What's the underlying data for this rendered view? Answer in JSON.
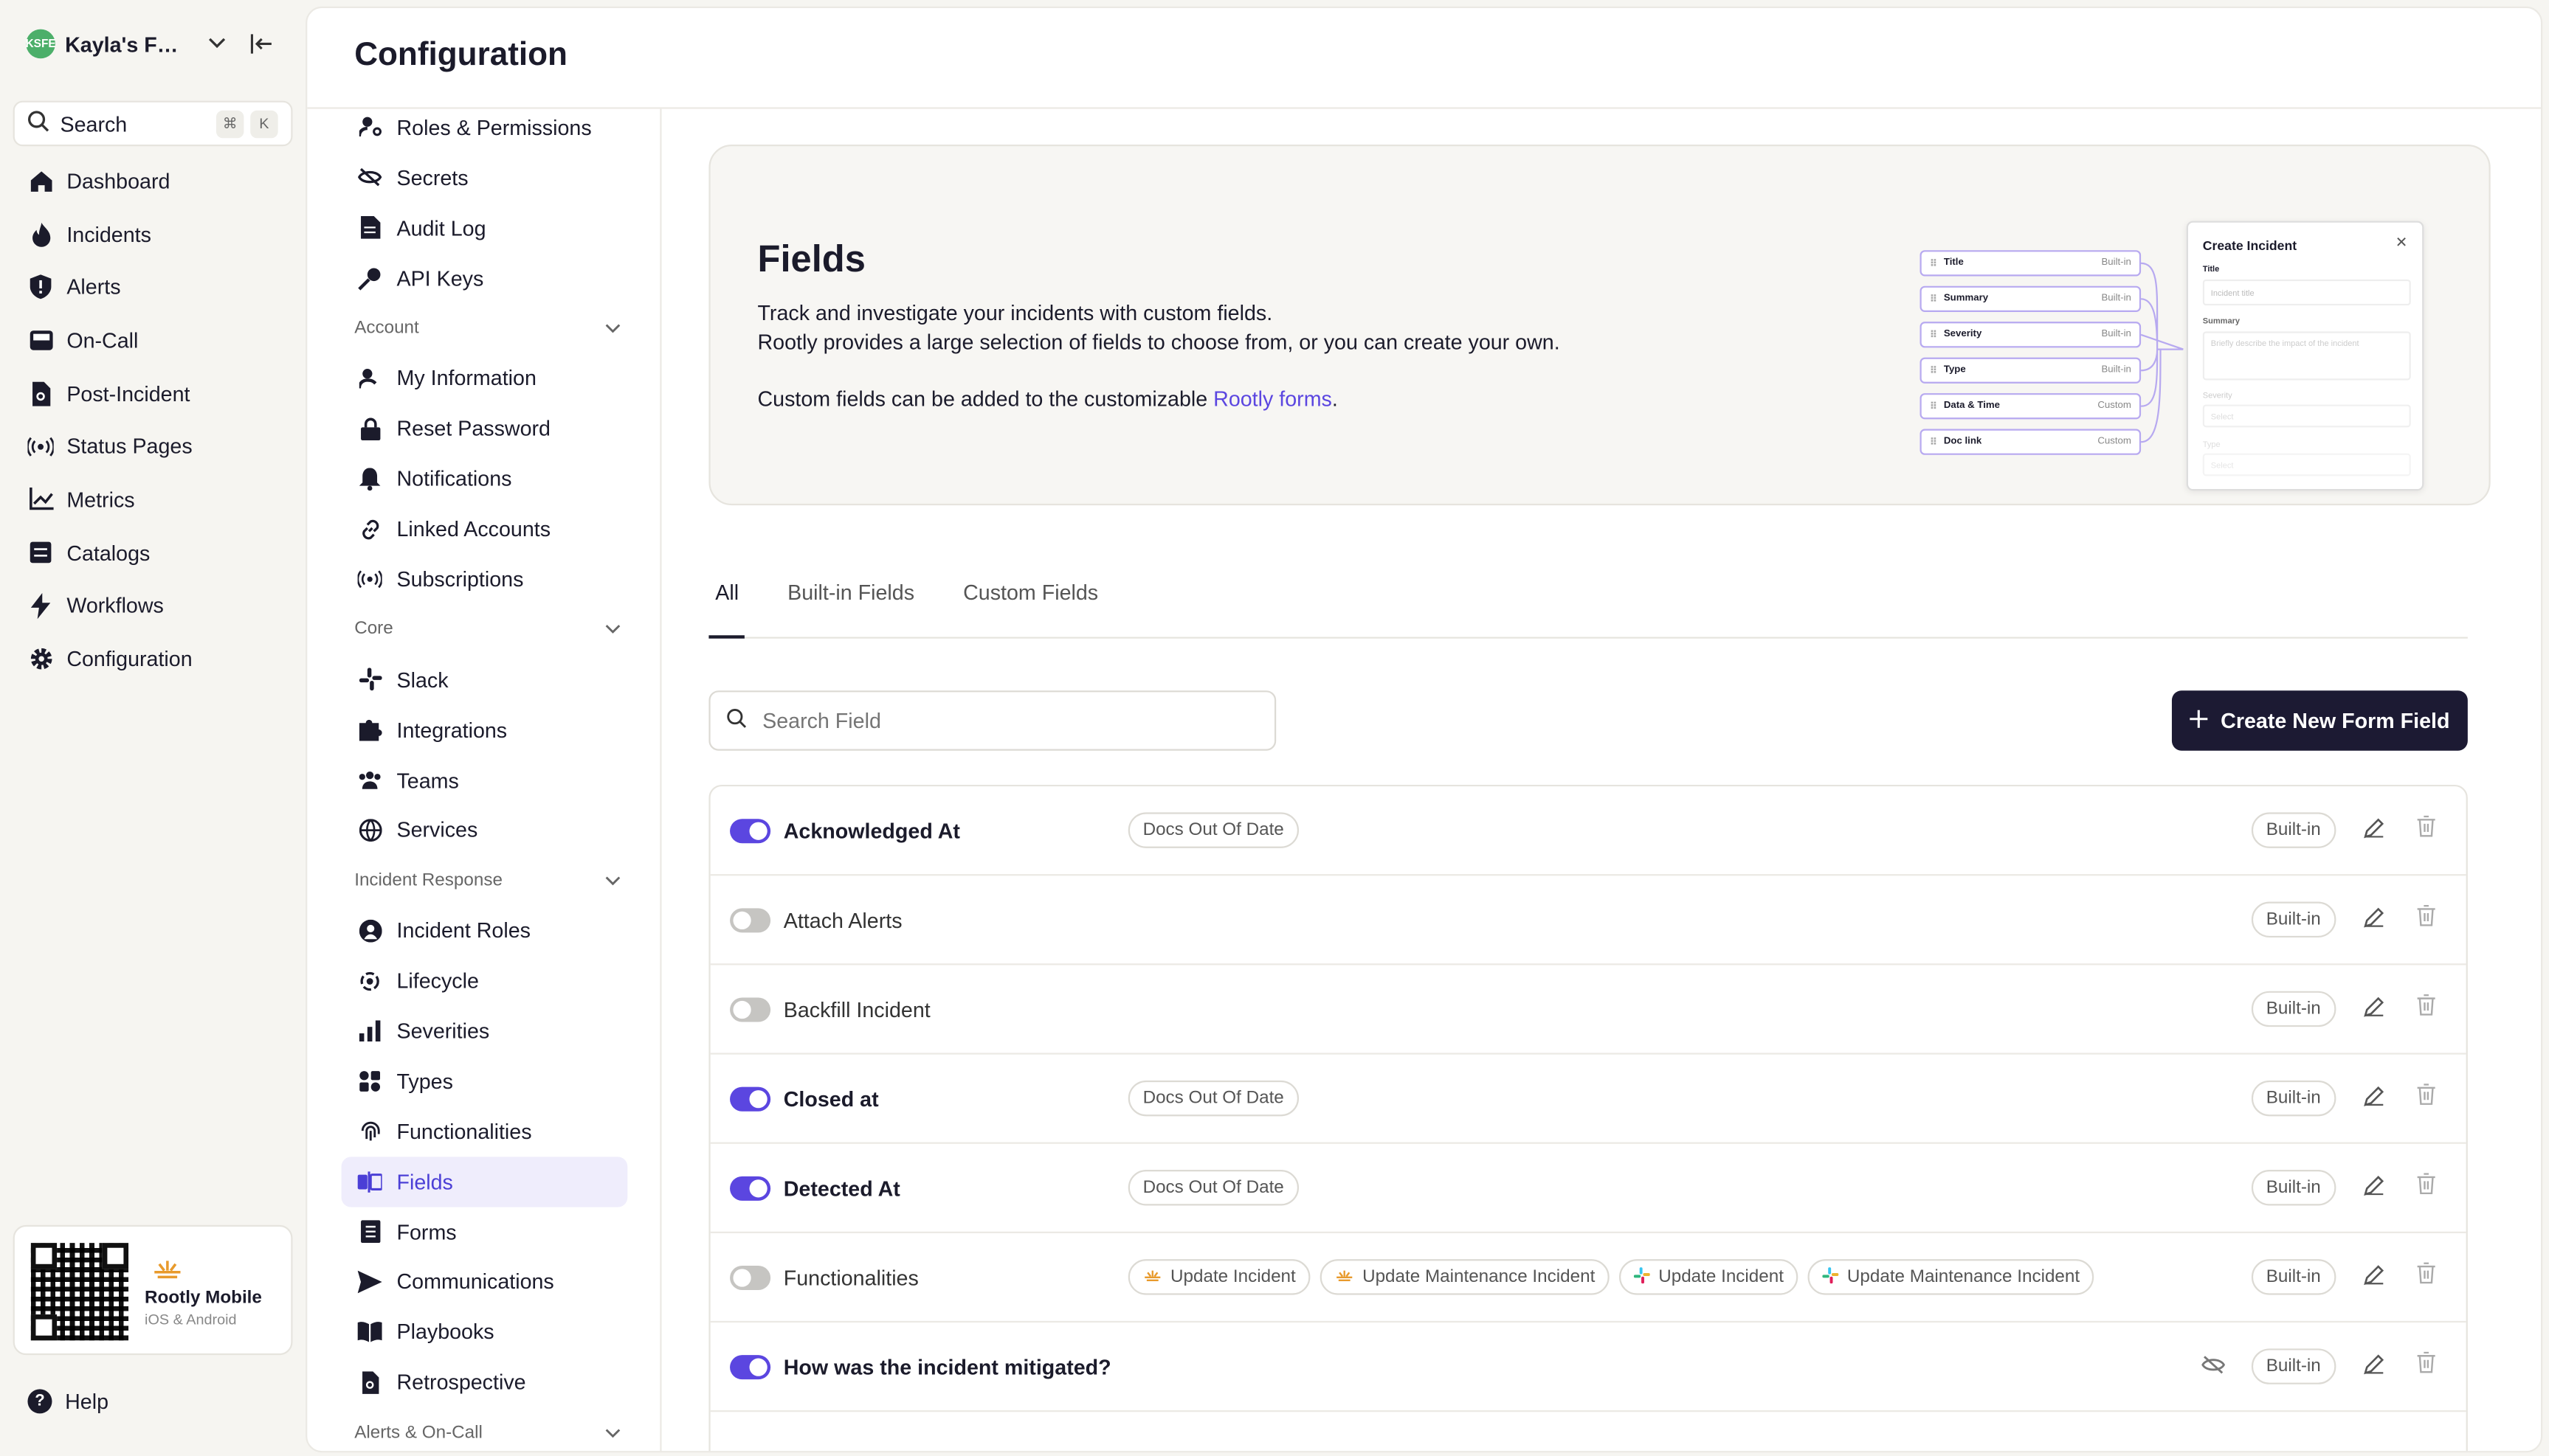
{
  "org": {
    "initials": "KSFE",
    "name": "Kayla's Fu..."
  },
  "search": {
    "label": "Search",
    "shortcut_cmd": "⌘",
    "shortcut_key": "K"
  },
  "nav": [
    {
      "label": "Dashboard",
      "icon": "home-icon"
    },
    {
      "label": "Incidents",
      "icon": "flame-icon"
    },
    {
      "label": "Alerts",
      "icon": "shield-alert-icon"
    },
    {
      "label": "On-Call",
      "icon": "pager-icon"
    },
    {
      "label": "Post-Incident",
      "icon": "document-search-icon"
    },
    {
      "label": "Status Pages",
      "icon": "broadcast-icon"
    },
    {
      "label": "Metrics",
      "icon": "chart-icon"
    },
    {
      "label": "Catalogs",
      "icon": "catalog-icon"
    },
    {
      "label": "Workflows",
      "icon": "bolt-icon"
    },
    {
      "label": "Configuration",
      "icon": "gear-icon"
    }
  ],
  "mobile": {
    "title": "Rootly Mobile",
    "subtitle": "iOS & Android"
  },
  "help": {
    "label": "Help"
  },
  "page": {
    "title": "Configuration"
  },
  "subnav": {
    "top_items": [
      "Roles & Permissions",
      "Secrets",
      "Audit Log",
      "API Keys"
    ],
    "account": {
      "label": "Account",
      "items": [
        "My Information",
        "Reset Password",
        "Notifications",
        "Linked Accounts",
        "Subscriptions"
      ]
    },
    "core": {
      "label": "Core",
      "items": [
        "Slack",
        "Integrations",
        "Teams",
        "Services"
      ]
    },
    "incident_response": {
      "label": "Incident Response",
      "items": [
        "Incident Roles",
        "Lifecycle",
        "Severities",
        "Types",
        "Functionalities",
        "Fields",
        "Forms",
        "Communications",
        "Playbooks",
        "Retrospective"
      ]
    },
    "alerts_oncall": {
      "label": "Alerts & On-Call"
    }
  },
  "hero": {
    "title": "Fields",
    "line1": "Track and investigate your incidents with custom fields.",
    "line2": "Rootly provides a large selection of fields to choose from, or you can create your own.",
    "line3_prefix": "Custom fields can be added to the customizable ",
    "line3_link": "Rootly forms",
    "line3_suffix": ".",
    "illustration": {
      "rows": [
        {
          "label": "Title",
          "tag": "Built-in"
        },
        {
          "label": "Summary",
          "tag": "Built-in"
        },
        {
          "label": "Severity",
          "tag": "Built-in"
        },
        {
          "label": "Type",
          "tag": "Built-in"
        },
        {
          "label": "Data & Time",
          "tag": "Custom"
        },
        {
          "label": "Doc link",
          "tag": "Custom"
        }
      ],
      "card_title": "Create Incident",
      "card_title_label": "Title",
      "card_title_placeholder": "Incident title",
      "card_summary_label": "Summary",
      "card_summary_placeholder": "Briefly describe the impact of the incident",
      "card_severity_label": "Severity",
      "card_severity_placeholder": "Select",
      "card_type_label": "Type",
      "card_type_placeholder": "Select"
    }
  },
  "tabs": [
    "All",
    "Built-in Fields",
    "Custom Fields"
  ],
  "field_search": {
    "placeholder": "Search Field"
  },
  "create_button": {
    "label": "Create New Form Field"
  },
  "fields": [
    {
      "name": "Acknowledged At",
      "enabled": true,
      "tags": [
        "Docs Out Of Date"
      ],
      "badge": "Built-in"
    },
    {
      "name": "Attach Alerts",
      "enabled": false,
      "tags": [],
      "badge": "Built-in"
    },
    {
      "name": "Backfill Incident",
      "enabled": false,
      "tags": [],
      "badge": "Built-in"
    },
    {
      "name": "Closed at",
      "enabled": true,
      "tags": [
        "Docs Out Of Date"
      ],
      "badge": "Built-in"
    },
    {
      "name": "Detected At",
      "enabled": true,
      "tags": [
        "Docs Out Of Date"
      ],
      "badge": "Built-in"
    },
    {
      "name": "Functionalities",
      "enabled": false,
      "tags": [
        "Update Incident",
        "Update Maintenance Incident",
        "Update Incident",
        "Update Maintenance Incident"
      ],
      "tag_icons": [
        "rootly-icon",
        "rootly-icon",
        "slack-icon",
        "slack-icon"
      ],
      "badge": "Built-in"
    },
    {
      "name": "How was the incident mitigated?",
      "enabled": true,
      "tags": [],
      "hidden_icon": true,
      "badge": "Built-in"
    }
  ],
  "colors": {
    "accent": "#5b46e0",
    "dark_button": "#1c1a33",
    "background": "#f6f5f1"
  }
}
